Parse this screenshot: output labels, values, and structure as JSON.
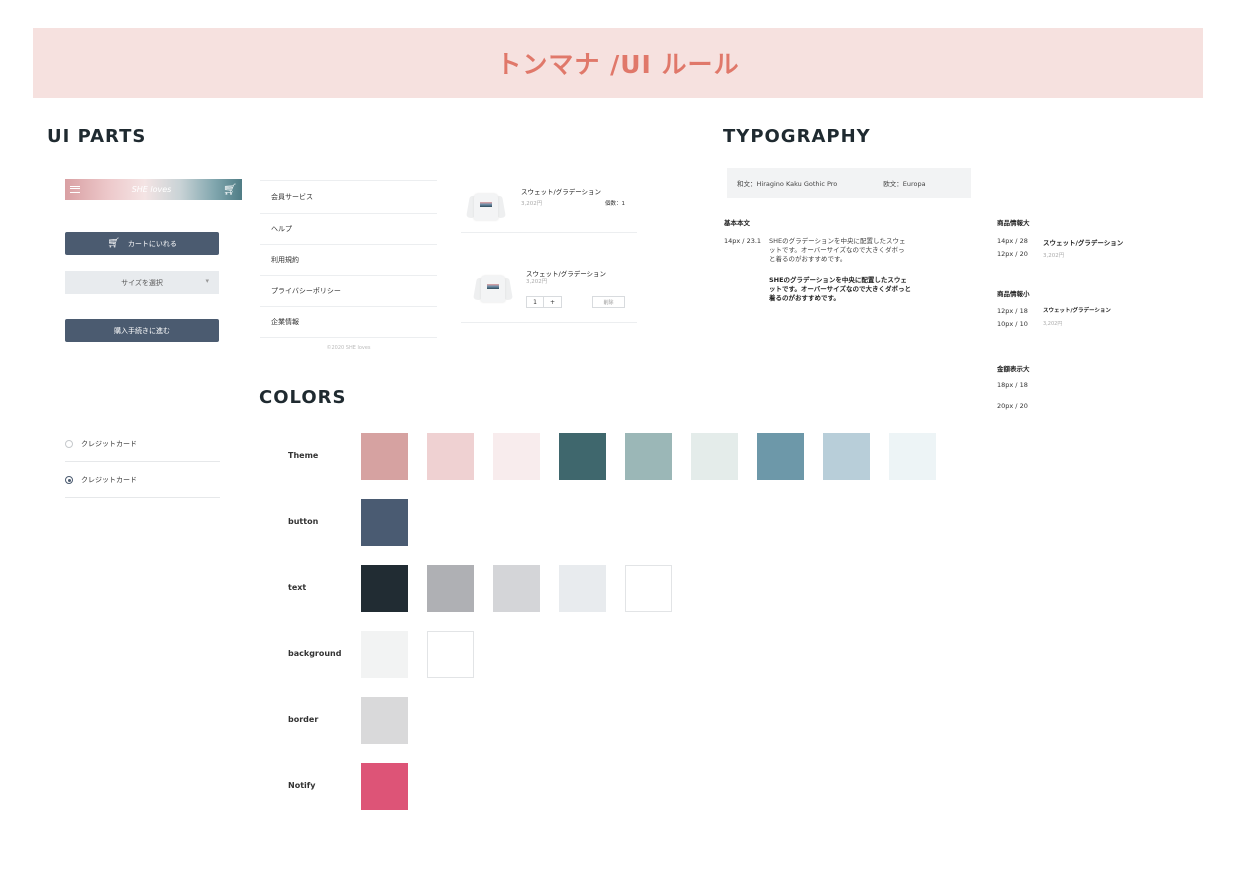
{
  "banner": {
    "title": "トンマナ /UI ルール"
  },
  "sections": {
    "ui_parts": "UI PARTS",
    "typography": "TYPOGRAPHY",
    "colors": "COLORS"
  },
  "ui_parts": {
    "header_logo": "SHE loves",
    "add_to_cart": "カートにいれる",
    "size_select": "サイズを選択",
    "checkout": "購入手続きに進む",
    "radio_options": [
      "クレジットカード",
      "クレジットカード"
    ],
    "menu": [
      "会員サービス",
      "ヘルプ",
      "利用規約",
      "プライバシーポリシー",
      "企業情報"
    ],
    "copyright": "©2020 SHE loves",
    "cart_item_1": {
      "name": "スウェット/グラデーション",
      "price": "3,202円",
      "qty": "個数：1"
    },
    "cart_item_2": {
      "name": "スウェット/グラデーション",
      "price": "3,202円",
      "qty_value": "1",
      "plus": "+",
      "delete": "削除"
    }
  },
  "typography": {
    "font_jp": "和文：Hiragino Kaku Gothic Pro",
    "font_en": "欧文：Europa",
    "basic_label": "基本本文",
    "basic_spec": "14px / 23.1",
    "basic_text": "SHEのグラデーションを中央に配置したスウェットです。オーバーサイズなので大きくダボっと着るのがおすすめです。",
    "basic_text_bold": "SHEのグラデーションを中央に配置したスウェットです。オーバーサイズなので大きくダボっと着るのがおすすめです。",
    "product_large_label": "商品情報大",
    "product_large_spec1": "14px / 28",
    "product_large_spec2": "12px / 20",
    "product_large_name": "スウェット/グラデーション",
    "product_large_price": "3,202円",
    "product_small_label": "商品情報小",
    "product_small_spec1": "12px / 18",
    "product_small_spec2": "10px / 10",
    "product_small_name": "スウェット/グラデーション",
    "product_small_price": "3,202円",
    "price_large_label": "金額表示大",
    "price_large_spec1": "18px / 18",
    "price_large_spec2": "20px / 20"
  },
  "colors": {
    "rows": [
      {
        "label": "Theme",
        "swatches": [
          "#d6a2a1",
          "#efd1d2",
          "#f8eced",
          "#3f676d",
          "#9bb7b7",
          "#e4ecea",
          "#6d98a9",
          "#b8ced9",
          "#edf4f6"
        ]
      },
      {
        "label": "button",
        "swatches": [
          "#4a5b72"
        ]
      },
      {
        "label": "text",
        "swatches": [
          "#212c33",
          "#afb0b4",
          "#d4d5d8",
          "#e8ebee",
          "#ffffff"
        ]
      },
      {
        "label": "background",
        "swatches": [
          "#f2f3f3",
          "#ffffff"
        ]
      },
      {
        "label": "border",
        "swatches": [
          "#d9d9da"
        ]
      },
      {
        "label": "Notify",
        "swatches": [
          "#dd5477"
        ]
      }
    ]
  }
}
